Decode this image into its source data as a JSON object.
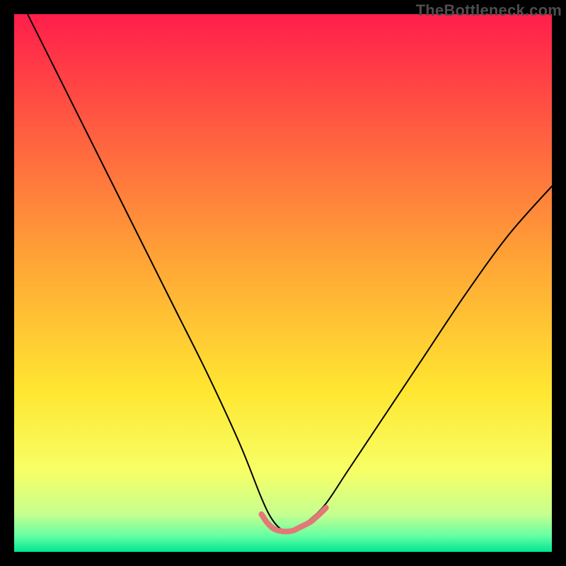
{
  "watermark": "TheBottleneck.com",
  "chart_data": {
    "type": "line",
    "title": "",
    "xlabel": "",
    "ylabel": "",
    "xlim": [
      0,
      100
    ],
    "ylim": [
      0,
      100
    ],
    "background_gradient": {
      "stops": [
        {
          "offset": 0.0,
          "color": "#FF1E4B"
        },
        {
          "offset": 0.45,
          "color": "#FFA236"
        },
        {
          "offset": 0.7,
          "color": "#FFE631"
        },
        {
          "offset": 0.85,
          "color": "#F7FF66"
        },
        {
          "offset": 0.93,
          "color": "#C6FF8F"
        },
        {
          "offset": 0.97,
          "color": "#66FFA3"
        },
        {
          "offset": 1.0,
          "color": "#00E693"
        }
      ]
    },
    "series": [
      {
        "name": "bottleneck-curve",
        "color": "#000000",
        "stroke_width": 2,
        "x": [
          0,
          6,
          12,
          18,
          24,
          30,
          36,
          42,
          46,
          48,
          50,
          52,
          55,
          58,
          62,
          68,
          76,
          84,
          92,
          100
        ],
        "y": [
          105,
          93,
          81,
          69,
          57,
          45,
          33,
          20,
          10,
          6,
          4,
          4,
          6,
          9,
          15,
          24,
          36,
          48,
          59,
          68
        ]
      },
      {
        "name": "trough-highlight",
        "color": "#E27878",
        "stroke_width": 8,
        "x": [
          46,
          47,
          48,
          49,
          50,
          51,
          52,
          53,
          55,
          56,
          57,
          58
        ],
        "y": [
          7,
          5.5,
          4.5,
          4,
          3.8,
          3.8,
          4,
          4.5,
          5.5,
          6.3,
          7.2,
          8.2
        ]
      }
    ]
  }
}
